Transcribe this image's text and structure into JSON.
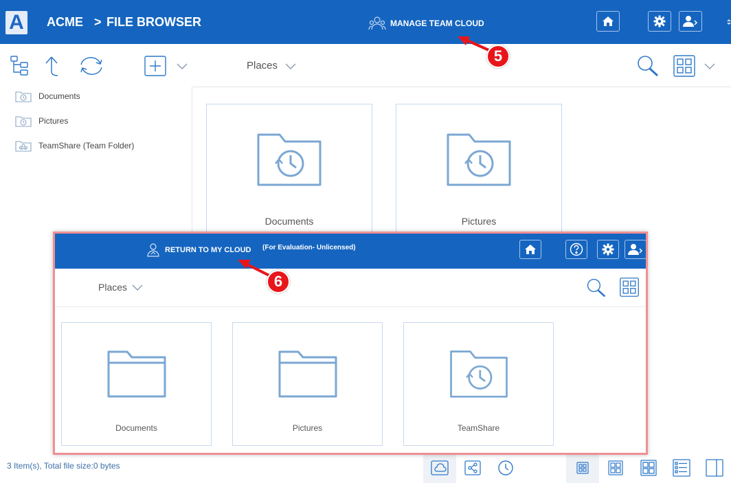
{
  "app": {
    "logo_letter": "A",
    "brand": "ACME",
    "separator": ">",
    "section": "FILE BROWSER",
    "accent_color": "#1565c0"
  },
  "header": {
    "manage_label": "MANAGE TEAM CLOUD",
    "buttons": [
      "home-icon",
      "gear-icon",
      "user-menu-icon"
    ]
  },
  "toolbar": {
    "tools": [
      "folder-tree-icon",
      "up-arrow-icon",
      "refresh-icon",
      "add-icon",
      "chevron-down-icon"
    ],
    "places_label": "Places",
    "right_tools": [
      "search-icon",
      "grid-view-icon",
      "chevron-down-icon"
    ]
  },
  "sidebar": {
    "items": [
      {
        "label": "Documents",
        "icon": "history-folder-icon"
      },
      {
        "label": "Pictures",
        "icon": "history-folder-icon"
      },
      {
        "label": "TeamShare (Team Folder)",
        "icon": "team-folder-icon"
      }
    ]
  },
  "main": {
    "tiles": [
      {
        "label": "Documents",
        "icon": "history-folder-icon"
      },
      {
        "label": "Pictures",
        "icon": "history-folder-icon"
      }
    ]
  },
  "status": {
    "text": "3 Item(s), Total file size:0 bytes",
    "bottom_icons": [
      "cloud-icon",
      "share-icon",
      "clock-icon",
      "small-grid-icon",
      "medium-grid-icon",
      "large-grid-icon",
      "list-view-icon",
      "preview-pane-icon"
    ]
  },
  "overlay": {
    "return_label": "RETURN TO MY CLOUD",
    "eval_label": "(For Evaluation- Unlicensed)",
    "buttons": [
      "home-icon",
      "help-icon",
      "gear-icon",
      "user-menu-icon"
    ],
    "places_label": "Places",
    "tiles": [
      {
        "label": "Documents",
        "icon": "folder-icon"
      },
      {
        "label": "Pictures",
        "icon": "folder-icon"
      },
      {
        "label": "TeamShare",
        "icon": "history-folder-icon"
      }
    ]
  },
  "annotations": {
    "marker_5": "5",
    "marker_6": "6",
    "marker_color": "#e8151b"
  }
}
